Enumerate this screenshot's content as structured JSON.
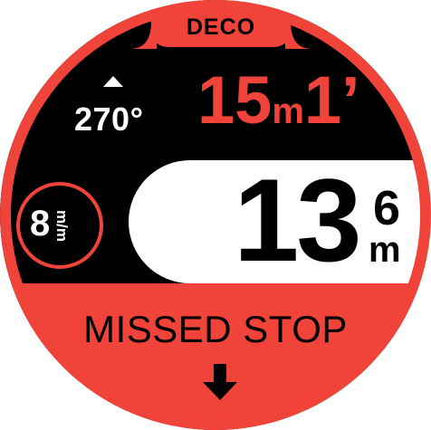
{
  "header": {
    "mode_label": "DECO"
  },
  "heading": {
    "value": "270°",
    "icon": "heading-up-triangle-icon"
  },
  "deco_stop": {
    "depth_value": "15",
    "depth_unit": "m",
    "time_value": "1’"
  },
  "depth": {
    "integer": "13",
    "decimal": "6",
    "unit": "m"
  },
  "ascent_rate": {
    "value": "8",
    "unit": "m/m"
  },
  "warning": {
    "text": "MISSED STOP",
    "icon": "down-arrow-icon"
  },
  "colors": {
    "accent": "#f0433a",
    "background": "#000000",
    "panel": "#ffffff"
  }
}
